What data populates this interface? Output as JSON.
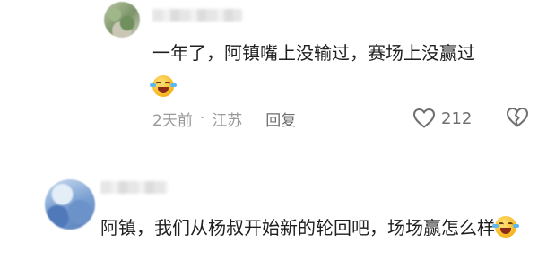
{
  "comments": [
    {
      "text": "一年了，阿镇嘴上没输过，赛场上没赢过",
      "emoji": "laugh-cry-emoji",
      "time": "2天前",
      "separator": "·",
      "location": "江苏",
      "reply_label": "回复",
      "likes": "212"
    },
    {
      "text": "阿镇，我们从杨叔开始新的轮回吧，场场赢怎么样",
      "emoji": "laugh-cry-emoji"
    }
  ],
  "colors": {
    "text": "#1f1f1f",
    "meta": "#9a9a9a",
    "action": "#6e6e6e"
  }
}
